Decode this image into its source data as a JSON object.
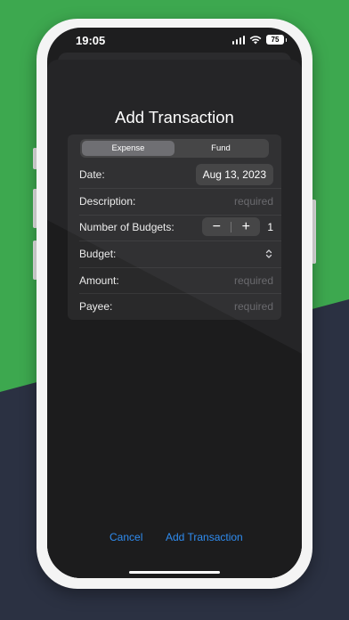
{
  "status_bar": {
    "time": "19:05",
    "battery": "75"
  },
  "sheet": {
    "title": "Add Transaction"
  },
  "segmented": {
    "options": [
      "Expense",
      "Fund"
    ],
    "selected": "Expense"
  },
  "form": {
    "date": {
      "label": "Date:",
      "value": "Aug 13, 2023"
    },
    "description": {
      "label": "Description:",
      "placeholder": "required"
    },
    "budgets": {
      "label": "Number of Budgets:",
      "minus": "−",
      "plus": "+",
      "value": "1"
    },
    "budget": {
      "label": "Budget:"
    },
    "amount": {
      "label": "Amount:",
      "placeholder": "required"
    },
    "payee": {
      "label": "Payee:",
      "placeholder": "required"
    }
  },
  "actions": {
    "cancel": "Cancel",
    "add": "Add Transaction"
  },
  "colors": {
    "accent": "#2f8cf0",
    "background_green": "#3da84f",
    "background_navy": "#2b3142"
  }
}
